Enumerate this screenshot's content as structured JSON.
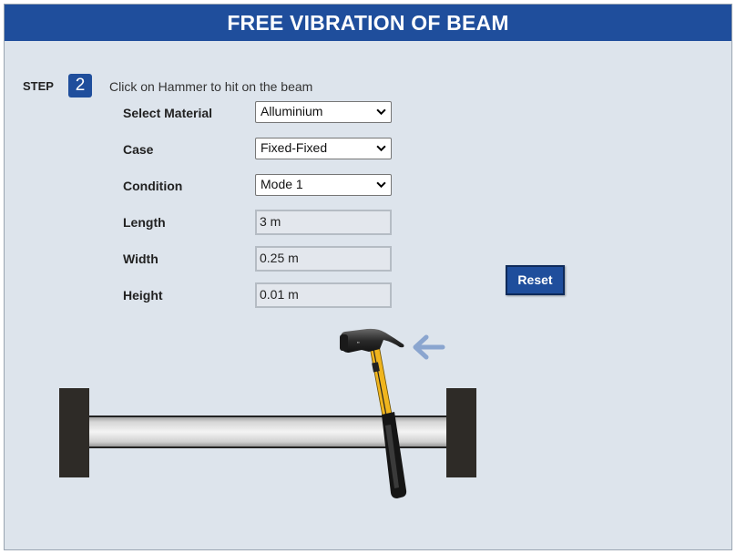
{
  "header": {
    "title": "FREE VIBRATION OF BEAM"
  },
  "step": {
    "label": "STEP",
    "number": "2",
    "instruction": "Click on Hammer to hit on the beam"
  },
  "form": {
    "material": {
      "label": "Select Material",
      "value": "Alluminium"
    },
    "case": {
      "label": "Case",
      "value": "Fixed-Fixed"
    },
    "condition": {
      "label": "Condition",
      "value": "Mode 1"
    },
    "length": {
      "label": "Length",
      "value": "3 m"
    },
    "width": {
      "label": "Width",
      "value": "0.25 m"
    },
    "height": {
      "label": "Height",
      "value": "0.01 m"
    }
  },
  "reset_button": {
    "label": "Reset"
  },
  "scene": {
    "hammer_icon": "hammer-icon",
    "arrow_icon": "arrow-left-icon",
    "colors": {
      "accent": "#1f4e9c",
      "support": "#2e2b27",
      "arrow": "#8aa5cf",
      "hammer_handle": "#f0b51e"
    }
  }
}
